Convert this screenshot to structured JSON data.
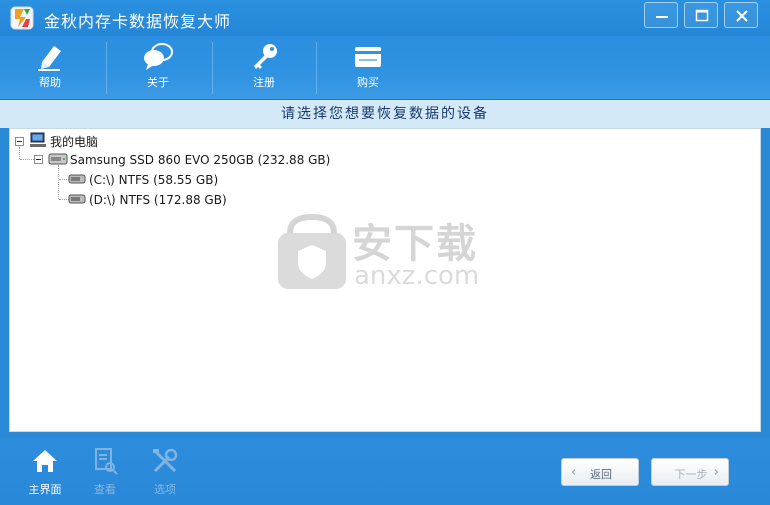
{
  "window": {
    "title": "金秋内存卡数据恢复大师"
  },
  "toolbar": {
    "help_label": "帮助",
    "about_label": "关于",
    "register_label": "注册",
    "buy_label": "购买"
  },
  "banner": {
    "text": "请选择您想要恢复数据的设备"
  },
  "tree": {
    "root_label": "我的电脑",
    "disk_label": "Samsung SSD 860 EVO 250GB (232.88 GB)",
    "partitions": [
      {
        "label": "(C:\\) NTFS (58.55 GB)"
      },
      {
        "label": "(D:\\) NTFS (172.88 GB)"
      }
    ]
  },
  "watermark": {
    "text": "安下载",
    "url": "anxz.com"
  },
  "bottom": {
    "home_label": "主界面",
    "view_label": "查看",
    "options_label": "选项",
    "back_label": "返回",
    "next_label": "下一步"
  }
}
